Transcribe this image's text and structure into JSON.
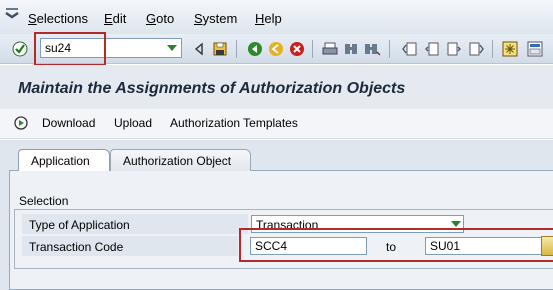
{
  "menu": {
    "items": [
      {
        "label": "Selections",
        "accel": "S",
        "rest": "elections"
      },
      {
        "label": "Edit",
        "accel": "E",
        "rest": "dit"
      },
      {
        "label": "Goto",
        "accel": "G",
        "rest": "oto"
      },
      {
        "label": "System",
        "accel": "S",
        "rest": "ystem"
      },
      {
        "label": "Help",
        "accel": "H",
        "rest": "elp"
      }
    ]
  },
  "toolbar": {
    "command_value": "su24",
    "icons": [
      "enter-icon",
      "back-arrow-icon",
      "save-icon",
      "back-icon",
      "exit-icon",
      "cancel-icon",
      "print-icon",
      "find-icon",
      "find-next-icon",
      "first-page-icon",
      "previous-page-icon",
      "next-page-icon",
      "last-page-icon",
      "create-session-icon",
      "shortcut-icon"
    ]
  },
  "page": {
    "title": "Maintain the Assignments of Authorization Objects"
  },
  "app_toolbar": {
    "download": "Download",
    "upload": "Upload",
    "templates": "Authorization Templates"
  },
  "tabs": [
    {
      "label": "Application",
      "active": true
    },
    {
      "label": "Authorization Object",
      "active": false
    }
  ],
  "selection": {
    "title": "Selection",
    "type_label": "Type of Application",
    "type_value": "Transaction",
    "tcode_label": "Transaction Code",
    "tcode_from": "SCC4",
    "to_label": "to",
    "tcode_to": "SU01"
  },
  "colors": {
    "highlight": "#b22b2b",
    "title": "#1c2a3b"
  }
}
